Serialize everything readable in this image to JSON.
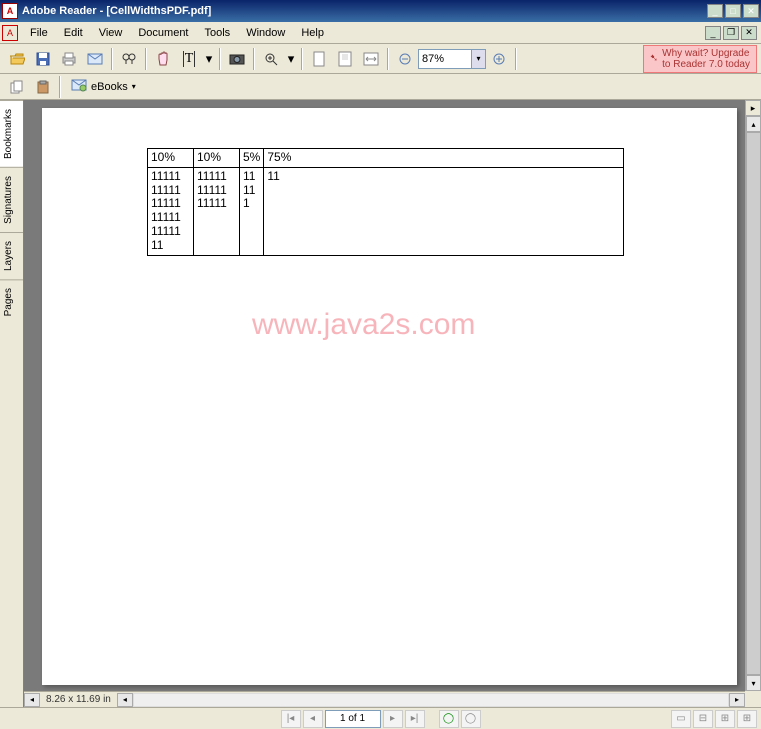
{
  "title": "Adobe Reader - [CellWidthsPDF.pdf]",
  "menu": {
    "file": "File",
    "edit": "Edit",
    "view": "View",
    "document": "Document",
    "tools": "Tools",
    "window": "Window",
    "help": "Help"
  },
  "toolbar": {
    "zoom": "87%"
  },
  "upgrade": {
    "line1": "Why wait? Upgrade",
    "line2": "to Reader 7.0 today"
  },
  "ebooks": {
    "label": "eBooks"
  },
  "tabs": {
    "bookmarks": "Bookmarks",
    "signatures": "Signatures",
    "layers": "Layers",
    "pages": "Pages"
  },
  "page_size": "8.26 x 11.69 in",
  "watermark": "www.java2s.com",
  "pagination": {
    "display": "1 of 1"
  },
  "table": {
    "header": [
      "10%",
      "10%",
      "5%",
      "75%"
    ],
    "row2": [
      "11111\n11111\n11111\n11111\n11111\n11",
      "11111\n11111\n11111",
      "11\n11\n1",
      "11"
    ]
  }
}
